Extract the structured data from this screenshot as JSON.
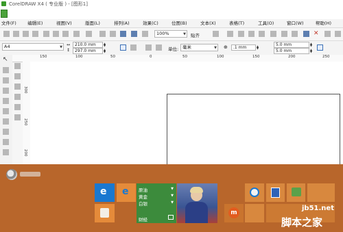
{
  "window": {
    "title": "CorelDRAW X4 ( 专业版 ) - [图形1]"
  },
  "menubar": {
    "items": [
      "文件(F)",
      "编辑(E)",
      "视图(V)",
      "版面(L)",
      "排列(A)",
      "效果(C)",
      "位图(B)",
      "文本(X)",
      "表格(T)",
      "工具(O)",
      "窗口(W)",
      "帮助(H)"
    ]
  },
  "toolbar": {
    "zoom": "100%",
    "snap_label": "贴齐"
  },
  "propbar": {
    "paper": "A4",
    "width": "210.0 mm",
    "height": "297.0 mm",
    "units_label": "单位:",
    "units_value": "毫米",
    "nudge": ".1 mm",
    "dup_x": "5.0 mm",
    "dup_y": "5.0 mm"
  },
  "ruler": {
    "h_numbers": [
      "150",
      "100",
      "50",
      "0",
      "50",
      "100",
      "150",
      "200",
      "250"
    ],
    "v_numbers": [
      "300",
      "250",
      "200"
    ]
  },
  "start_menu": {
    "money_tile": {
      "rows": [
        "原油",
        "黄金",
        "白银"
      ],
      "label": "财经"
    }
  },
  "watermark": {
    "url": "jb51.net",
    "text": "脚本之家"
  },
  "colors": {
    "start_bg": "#b8662b",
    "tile_orange": "#e58b3a",
    "tile_blue": "#1a78d0",
    "tile_green": "#3c8b3c"
  }
}
